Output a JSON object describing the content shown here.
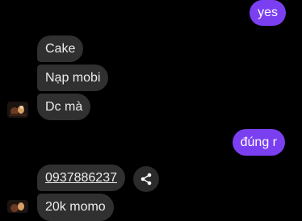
{
  "messages": [
    {
      "id": "yes",
      "direction": "outgoing",
      "text": "yes"
    },
    {
      "id": "cake",
      "direction": "incoming",
      "text": "Cake"
    },
    {
      "id": "napmobi",
      "direction": "incoming",
      "text": "Nạp mobi"
    },
    {
      "id": "dcma",
      "direction": "incoming",
      "text": "Dc mà"
    },
    {
      "id": "dungr",
      "direction": "outgoing",
      "text": "đúng r"
    },
    {
      "id": "phone",
      "direction": "incoming",
      "text": "0937886237"
    },
    {
      "id": "20k",
      "direction": "incoming",
      "text": "20k momo"
    }
  ],
  "icons": {
    "share": "share-icon",
    "avatar": "contact-avatar"
  },
  "colors": {
    "background": "#000000",
    "outgoing_bubble": "#7b3ff2",
    "incoming_bubble": "#303030",
    "text_light": "#ececec"
  }
}
